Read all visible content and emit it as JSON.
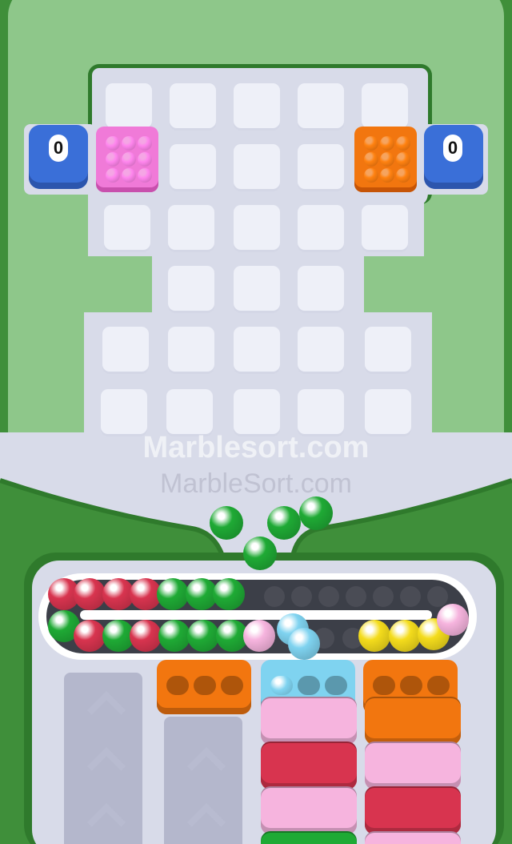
{
  "counters": {
    "left": "0",
    "right": "0"
  },
  "watermark": {
    "primary": "Marblesort.com",
    "secondary": "MarbleSort.com"
  },
  "colors": {
    "background_green": "#3f8f3a",
    "board_green": "#8ec78a",
    "floor": "#d8dbe9",
    "tile": "#eef0f8",
    "pink": "#f07ad8",
    "orange": "#f2760f",
    "blue": "#3a6fd8",
    "red": "#d8344f",
    "green": "#1faa35",
    "cyan": "#7fd3f0",
    "yellow": "#f4dc1c",
    "light_pink": "#f6b4de"
  },
  "boxes": [
    {
      "color": "pink",
      "side": "left"
    },
    {
      "color": "orange",
      "side": "right"
    }
  ],
  "conveyor": {
    "top_row": [
      "red",
      "red",
      "red",
      "red",
      "green",
      "green",
      "green",
      "empty",
      "empty",
      "empty",
      "empty",
      "empty",
      "empty",
      "empty",
      "empty"
    ],
    "bottom_row": [
      "green",
      "red",
      "green",
      "red",
      "green",
      "green",
      "green",
      "light_pink",
      "cyan",
      "cyan",
      "empty",
      "empty",
      "yellow",
      "yellow",
      "yellow",
      "light_pink"
    ]
  },
  "falling_balls": [
    "green",
    "green",
    "green",
    "green"
  ],
  "cups": [
    {
      "color": "orange",
      "holes_filled": 0
    },
    {
      "color": "cyan",
      "holes_filled": 1
    },
    {
      "color": "orange",
      "holes_filled": 0
    }
  ],
  "stacks": [
    {
      "column": 1,
      "blocks": []
    },
    {
      "column": 2,
      "blocks": []
    },
    {
      "column": 3,
      "blocks": [
        "light_pink",
        "red",
        "light_pink",
        "green"
      ]
    },
    {
      "column": 4,
      "blocks": [
        "orange",
        "light_pink",
        "red",
        "light_pink"
      ]
    }
  ]
}
